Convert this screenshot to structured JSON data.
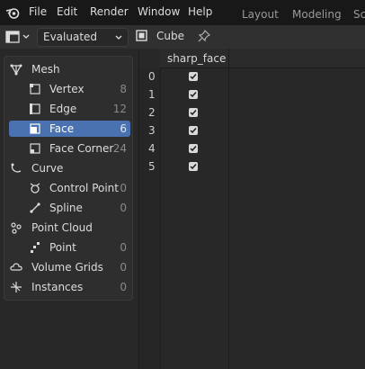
{
  "menubar": {
    "items": [
      "File",
      "Edit",
      "Render",
      "Window",
      "Help"
    ],
    "workspace_tabs": [
      "Layout",
      "Modeling",
      "Sc"
    ]
  },
  "header": {
    "mode": "Evaluated",
    "object_name": "Cube"
  },
  "domains": [
    {
      "label": "Mesh",
      "count": "",
      "icon": "mesh-icon",
      "level": 0
    },
    {
      "label": "Vertex",
      "count": "8",
      "icon": "vertex-icon",
      "level": 1
    },
    {
      "label": "Edge",
      "count": "12",
      "icon": "edge-icon",
      "level": 1
    },
    {
      "label": "Face",
      "count": "6",
      "icon": "face-icon",
      "level": 1,
      "active": true
    },
    {
      "label": "Face Corner",
      "count": "24",
      "icon": "face-corner-icon",
      "level": 1
    },
    {
      "label": "Curve",
      "count": "",
      "icon": "curve-icon",
      "level": 0
    },
    {
      "label": "Control Point",
      "count": "0",
      "icon": "control-point-icon",
      "level": 1
    },
    {
      "label": "Spline",
      "count": "0",
      "icon": "spline-icon",
      "level": 1
    },
    {
      "label": "Point Cloud",
      "count": "",
      "icon": "point-cloud-icon",
      "level": 0
    },
    {
      "label": "Point",
      "count": "0",
      "icon": "point-icon",
      "level": 1
    },
    {
      "label": "Volume Grids",
      "count": "0",
      "icon": "volume-icon",
      "level": 0
    },
    {
      "label": "Instances",
      "count": "0",
      "icon": "instances-icon",
      "level": 0
    }
  ],
  "spreadsheet": {
    "column": "sharp_face",
    "rows": [
      {
        "index": "0",
        "checked": true
      },
      {
        "index": "1",
        "checked": true
      },
      {
        "index": "2",
        "checked": true
      },
      {
        "index": "3",
        "checked": true
      },
      {
        "index": "4",
        "checked": true
      },
      {
        "index": "5",
        "checked": true
      }
    ]
  },
  "colors": {
    "accent": "#4a72b0",
    "background": "#1d1d1d",
    "panel": "#282828"
  }
}
